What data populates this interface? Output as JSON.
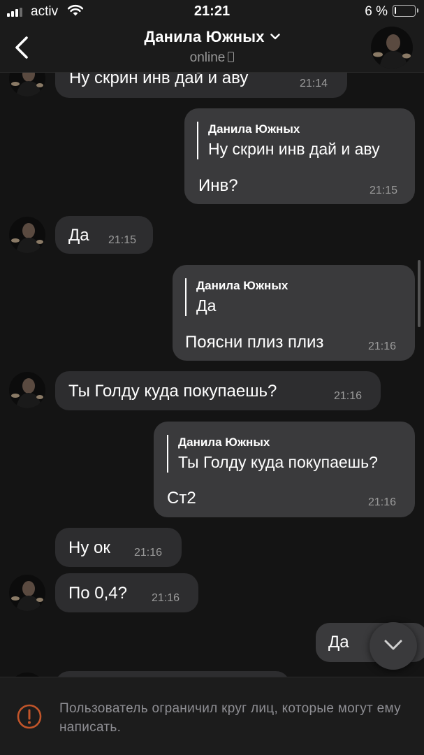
{
  "status_bar": {
    "carrier": "activ",
    "time": "21:21",
    "battery_percent": "6 %",
    "battery_level": 0.06,
    "signal_icon": "signal-bars-icon",
    "wifi_icon": "wifi-icon"
  },
  "header": {
    "contact_name": "Данила Южных",
    "status": "online",
    "back_icon": "chevron-left-icon",
    "dropdown_icon": "chevron-down-icon",
    "device_icon": "mobile-phone-icon"
  },
  "messages": [
    {
      "direction": "in",
      "text": "Ну скрин инв дай и аву",
      "time": "21:14"
    },
    {
      "direction": "out",
      "quote_author": "Данила Южных",
      "quote_text": "Ну скрин инв дай и аву",
      "text": "Инв?",
      "time": "21:15"
    },
    {
      "direction": "in",
      "text": "Да",
      "time": "21:15"
    },
    {
      "direction": "out",
      "quote_author": "Данила Южных",
      "quote_text": "Да",
      "text": "Поясни плиз плиз",
      "time": "21:16"
    },
    {
      "direction": "in",
      "text": "Ты Голду куда покупаешь?",
      "time": "21:16"
    },
    {
      "direction": "out",
      "quote_author": "Данила Южных",
      "quote_text": "Ты Голду куда покупаешь?",
      "text": "Ст2",
      "time": "21:16"
    },
    {
      "direction": "in",
      "text": "Ну ок",
      "time": "21:16"
    },
    {
      "direction": "in",
      "text": "По 0,4?",
      "time": "21:16"
    },
    {
      "direction": "out",
      "text": "Да",
      "time": ""
    }
  ],
  "scroll_down_icon": "chevron-down-icon",
  "footer": {
    "notice": "Пользователь ограничил круг лиц, которые могут ему написать.",
    "warning_icon": "exclamation-circle-icon"
  },
  "colors": {
    "background": "#141414",
    "incoming_bubble": "#2d2d2f",
    "outgoing_bubble": "#3a3a3c",
    "warning": "#c2552a"
  }
}
